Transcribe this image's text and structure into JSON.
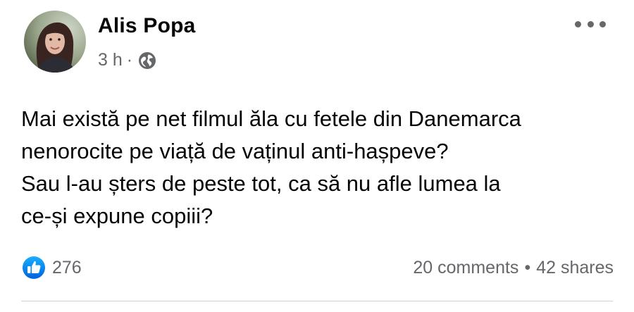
{
  "post": {
    "author": "Alis Popa",
    "time": "3 h",
    "separator": "·",
    "privacy_icon": "globe-icon",
    "more_icon": "more-options-icon",
    "text_lines": [
      "Mai există pe net filmul ăla cu fetele din Danemarca",
      "nenorocite pe viață de vaținul anti-hașpeve?",
      "Sau l-au șters de peste tot, ca să nu afle lumea la",
      "ce-și expune copiii?"
    ]
  },
  "footer": {
    "reaction_icon": "like-icon",
    "reaction_count": "276",
    "comments": "20 comments",
    "bullet": "•",
    "shares": "42 shares"
  },
  "colors": {
    "text_primary": "#050505",
    "text_secondary": "#65676b",
    "like_blue": "#1877f2",
    "divider": "#ced0d4"
  }
}
